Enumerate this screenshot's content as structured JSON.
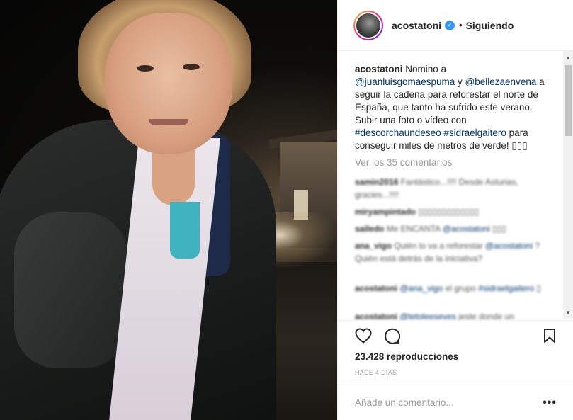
{
  "post": {
    "username": "acostatoni",
    "verified_glyph": "✓",
    "separator": "•",
    "follow_status": "Siguiendo",
    "caption": {
      "username": "acostatoni",
      "t1": " Nomino a ",
      "mention1": "@juanluisgomaespuma",
      "t2": " y ",
      "mention2": "@bellezaenvena",
      "t3": " a seguir la cadena para reforestar el norte de España, que tanto ha sufrido este verano. Subir una foto o vídeo con ",
      "tag1": "#descorchaundeseo",
      "t4": " ",
      "tag2": "#sidraelgaitero",
      "t5": " para conseguir miles de metros de verde! ▯▯▯"
    },
    "view_all_comments": "Ver los 35 comentarios",
    "comments": [
      {
        "user": "samin2016",
        "text": " Fantástico...!!!! Desde Asturias, gracies...!!!!"
      },
      {
        "user": "miryampintado",
        "text": " ▯▯▯▯▯▯▯▯▯▯▯▯▯"
      },
      {
        "user": "sailedo",
        "text": " Me ENCANTA ",
        "mention": "@acostatoni",
        "tail": " ▯▯▯"
      },
      {
        "user": "ana_vigo",
        "text": " Quién lo va a reforestar ",
        "mention": "@acostatoni",
        "tail": " ? Quién está detrás de la iniciativa?"
      },
      {
        "user": "acostatoni",
        "text": " ",
        "mention": "@ana_vigo",
        "tail": " el grupo ",
        "mention2": "#sidraelgaitero",
        "tail2": " ▯"
      },
      {
        "user": "acostatoni",
        "text": " ",
        "mention": "@tetoleeseves",
        "tail": " jeste donde un"
      }
    ],
    "views": "23.428 reproducciones",
    "time": "HACE 4 DÍAS",
    "add_comment_placeholder": "Añade un comentario...",
    "more": "•••",
    "scroll_up": "▲",
    "scroll_down": "▼"
  }
}
